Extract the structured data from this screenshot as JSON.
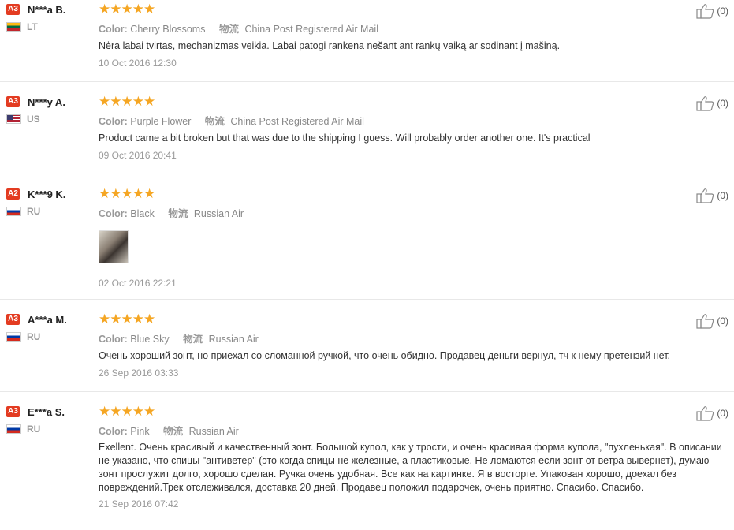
{
  "labels": {
    "color": "Color:",
    "shipping": "物流"
  },
  "reviews": [
    {
      "level": "A3",
      "name": "N***a B.",
      "flag": "lt",
      "country": "LT",
      "stars": "★★★★★",
      "color": "Cherry Blossoms",
      "shipping": "China Post Registered Air Mail",
      "text": "Nėra labai tvirtas, mechanizmas veikia. Labai patogi rankena nešant ant rankų vaiką ar sodinant į mašiną.",
      "date": "10 Oct 2016 12:30",
      "helpful": "(0)"
    },
    {
      "level": "A3",
      "name": "N***y A.",
      "flag": "us",
      "country": "US",
      "stars": "★★★★★",
      "color": "Purple Flower",
      "shipping": "China Post Registered Air Mail",
      "text": "Product came a bit broken but that was due to the shipping I guess. Will probably order another one. It's practical",
      "date": "09 Oct 2016 20:41",
      "helpful": "(0)"
    },
    {
      "level": "A2",
      "name": "K***9 K.",
      "flag": "ru",
      "country": "RU",
      "stars": "★★★★★",
      "color": "Black",
      "shipping": "Russian Air",
      "text": "",
      "date": "02 Oct 2016 22:21",
      "helpful": "(0)",
      "has_photo": true
    },
    {
      "level": "A3",
      "name": "A***a M.",
      "flag": "ru",
      "country": "RU",
      "stars": "★★★★★",
      "color": "Blue Sky",
      "shipping": "Russian Air",
      "text": "Очень хороший зонт, но приехал со сломанной ручкой, что очень обидно. Продавец деньги вернул, тч к нему претензий нет.",
      "date": "26 Sep 2016 03:33",
      "helpful": "(0)"
    },
    {
      "level": "A3",
      "name": "E***a S.",
      "flag": "ru",
      "country": "RU",
      "stars": "★★★★★",
      "color": "Pink",
      "shipping": "Russian Air",
      "text": "Exellent. Очень красивый и качественный зонт. Большой купол, как у трости, и очень красивая форма купола, \"пухленькая\". В описании не указано, что спицы \"антиветер\" (это когда спицы не железные, а пластиковые. Не ломаются если зонт от ветра вывернет), думаю зонт прослужит долго, хорошо сделан. Ручка очень удобная. Все как на картинке. Я в восторге. Упакован хорошо, доехал без повреждений.Трек отслеживался, доставка 20 дней. Продавец положил подарочек, очень приятно. Спасибо. Спасибо.",
      "date": "21 Sep 2016 07:42",
      "helpful": "(0)"
    }
  ]
}
